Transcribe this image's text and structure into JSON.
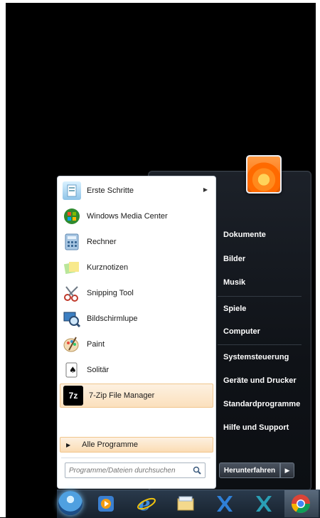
{
  "start_menu": {
    "programs": [
      {
        "label": "Erste Schritte",
        "icon": "getting-started-icon",
        "has_submenu": true
      },
      {
        "label": "Windows Media Center",
        "icon": "media-center-icon"
      },
      {
        "label": "Rechner",
        "icon": "calculator-icon"
      },
      {
        "label": "Kurznotizen",
        "icon": "sticky-notes-icon"
      },
      {
        "label": "Snipping Tool",
        "icon": "scissors-icon"
      },
      {
        "label": "Bildschirmlupe",
        "icon": "magnifier-icon"
      },
      {
        "label": "Paint",
        "icon": "paint-palette-icon"
      },
      {
        "label": "Solitär",
        "icon": "solitaire-card-icon"
      },
      {
        "label": "7-Zip File Manager",
        "icon": "7zip-icon",
        "selected": true
      }
    ],
    "all_programs": "Alle Programme",
    "search_placeholder": "Programme/Dateien durchsuchen",
    "right_items": [
      "Dokumente",
      "Bilder",
      "Musik",
      "Spiele",
      "Computer",
      "Systemsteuerung",
      "Geräte und Drucker",
      "Standardprogramme",
      "Hilfe und Support"
    ],
    "shutdown_label": "Herunterfahren",
    "shutdown_arrow": "▶"
  },
  "taskbar": {
    "items": [
      "start-orb-icon",
      "media-player-icon",
      "internet-explorer-icon",
      "file-explorer-icon",
      "x-app-icon",
      "x-app-icon",
      "chrome-icon"
    ]
  },
  "colors": {
    "selection_bg": "#fbe0bd",
    "right_pane_bg": "#141920",
    "taskbar_bg": "#1f2d3b"
  }
}
